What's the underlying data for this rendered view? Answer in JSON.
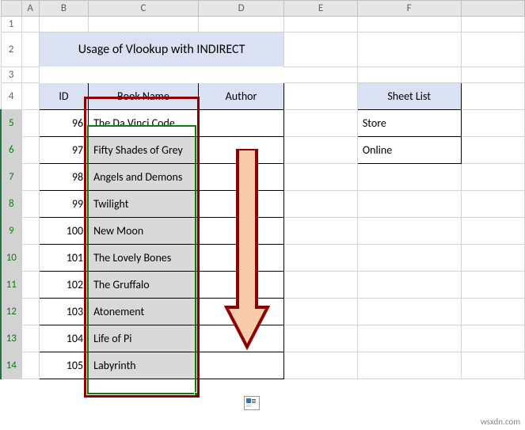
{
  "columns": [
    "",
    "A",
    "B",
    "C",
    "D",
    "E",
    "F"
  ],
  "rows": [
    "1",
    "2",
    "3",
    "4",
    "5",
    "6",
    "7",
    "8",
    "9",
    "10",
    "11",
    "12",
    "13",
    "14"
  ],
  "title": "Usage of Vlookup with INDIRECT",
  "main_headers": {
    "id": "ID",
    "book": "Book Name",
    "author": "Author"
  },
  "side_header": "Sheet List",
  "side_list": [
    "Store",
    "Online"
  ],
  "data": [
    {
      "id": 96,
      "book": "The Da Vinci Code"
    },
    {
      "id": 97,
      "book": "Fifty Shades of Grey"
    },
    {
      "id": 98,
      "book": "Angels and Demons"
    },
    {
      "id": 99,
      "book": "Twilight"
    },
    {
      "id": 100,
      "book": "New Moon"
    },
    {
      "id": 101,
      "book": "The Lovely Bones"
    },
    {
      "id": 102,
      "book": "The Gruffalo"
    },
    {
      "id": 103,
      "book": "Atonement"
    },
    {
      "id": 104,
      "book": "Life of Pi"
    },
    {
      "id": 105,
      "book": "Labyrinth"
    }
  ],
  "autofill_icon_glyph": "⎘",
  "watermark": "wsxdn.com"
}
